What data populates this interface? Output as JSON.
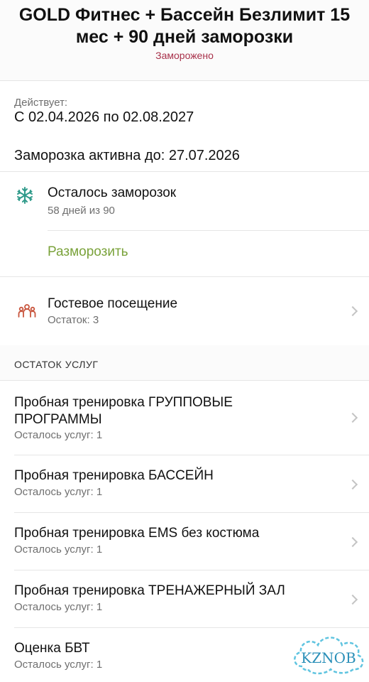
{
  "header": {
    "title": "GOLD Фитнес + Бассейн Безлимит 15 мес + 90 дней заморозки",
    "status": "Заморожено"
  },
  "validity": {
    "label": "Действует:",
    "value": "С 02.04.2026 по 02.08.2027"
  },
  "freeze": {
    "active_until": "Заморозка активна до: 27.07.2026",
    "remaining_title": "Осталось заморозок",
    "remaining_sub": "58 дней из 90",
    "icon": "snowflake-icon",
    "unfreeze_label": "Разморозить",
    "accent_color": "#7aa23a"
  },
  "guest": {
    "title": "Гостевое посещение",
    "sub": "Остаток: 3",
    "icon": "people-icon"
  },
  "services": {
    "heading": "ОСТАТОК УСЛУГ",
    "items": [
      {
        "title": "Пробная тренировка ГРУППОВЫЕ ПРОГРАММЫ",
        "sub": "Осталось услуг: 1"
      },
      {
        "title": "Пробная тренировка БАССЕЙН",
        "sub": "Осталось услуг: 1"
      },
      {
        "title": "Пробная тренировка EMS без костюма",
        "sub": "Осталось услуг: 1"
      },
      {
        "title": "Пробная тренировка ТРЕНАЖЕРНЫЙ ЗАЛ",
        "sub": "Осталось услуг: 1"
      },
      {
        "title": "Оценка БВТ",
        "sub": "Осталось услуг: 1"
      }
    ]
  },
  "watermark": {
    "text": "KZNOB"
  },
  "colors": {
    "status": "#a8314a",
    "icon_red": "#c8553d",
    "icon_teal": "#2f9a8a"
  }
}
